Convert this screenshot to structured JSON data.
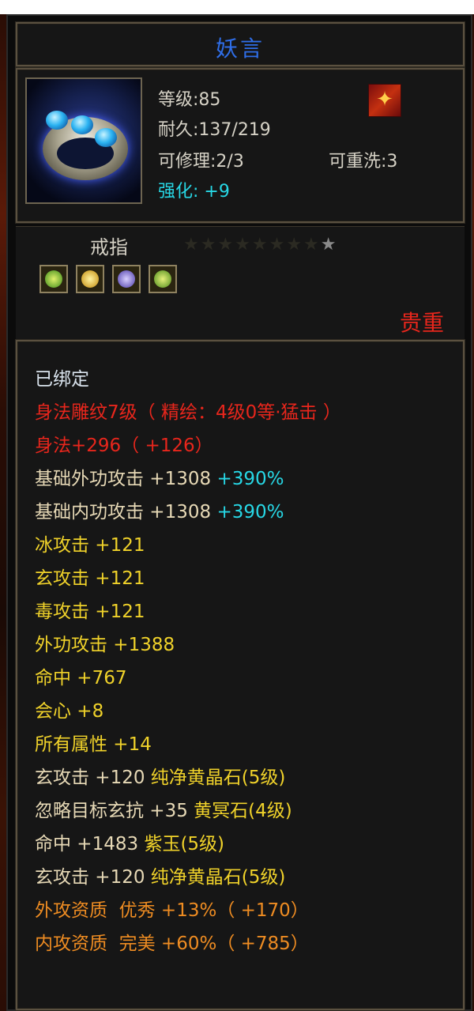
{
  "item": {
    "name": "妖言",
    "level": "等级:85",
    "durability": "耐久:137/219",
    "repairable": "可修理:2/3",
    "rewash": "可重洗:3",
    "enhance": "强化: +9",
    "type": "戒指",
    "stars": "★★★★★★★★",
    "last_star": "★",
    "rarity": "贵重"
  },
  "colors": {
    "title": "#2f6ee8",
    "red": "#e8261c",
    "cyan": "#27d8e6",
    "yellow": "#f0d22a",
    "beige": "#e7d9b6",
    "orange": "#ee8c22",
    "white": "#d8e2ec"
  },
  "icons": [
    "ring-item-icon",
    "class-emblem-icon",
    "gem-slot-green",
    "gem-slot-yellow",
    "gem-slot-purple",
    "gem-slot-green"
  ],
  "attributes": [
    {
      "parts": [
        {
          "text": "已绑定",
          "color": "white"
        }
      ]
    },
    {
      "parts": [
        {
          "text": "身法雕纹7级（ 精绘：4级0等·猛击 ）",
          "color": "red"
        }
      ]
    },
    {
      "parts": [
        {
          "text": "身法+296（ +126）",
          "color": "red"
        }
      ]
    },
    {
      "parts": [
        {
          "text": "基础外功攻击 +1308 ",
          "color": "beige"
        },
        {
          "text": "+390%",
          "color": "cyan"
        }
      ]
    },
    {
      "parts": [
        {
          "text": "基础内功攻击 +1308 ",
          "color": "beige"
        },
        {
          "text": "+390%",
          "color": "cyan"
        }
      ]
    },
    {
      "parts": [
        {
          "text": "冰攻击 +121",
          "color": "yellow"
        }
      ]
    },
    {
      "parts": [
        {
          "text": "玄攻击 +121",
          "color": "yellow"
        }
      ]
    },
    {
      "parts": [
        {
          "text": "毒攻击 +121",
          "color": "yellow"
        }
      ]
    },
    {
      "parts": [
        {
          "text": "外功攻击 +1388",
          "color": "yellow"
        }
      ]
    },
    {
      "parts": [
        {
          "text": "命中 +767",
          "color": "yellow"
        }
      ]
    },
    {
      "parts": [
        {
          "text": "会心 +8",
          "color": "yellow"
        }
      ]
    },
    {
      "parts": [
        {
          "text": "所有属性 +14",
          "color": "yellow"
        }
      ]
    },
    {
      "parts": [
        {
          "text": "玄攻击 +120 ",
          "color": "beige"
        },
        {
          "text": "纯净黄晶石(5级)",
          "color": "yellow"
        }
      ]
    },
    {
      "parts": [
        {
          "text": "忽略目标玄抗 +35 ",
          "color": "beige"
        },
        {
          "text": "黄冥石(4级)",
          "color": "yellow"
        }
      ]
    },
    {
      "parts": [
        {
          "text": "命中 +1483 ",
          "color": "beige"
        },
        {
          "text": "紫玉(5级)",
          "color": "yellow"
        }
      ]
    },
    {
      "parts": [
        {
          "text": "玄攻击 +120 ",
          "color": "beige"
        },
        {
          "text": "纯净黄晶石(5级)",
          "color": "yellow"
        }
      ]
    },
    {
      "parts": [
        {
          "text": "外攻资质  优秀 +13%（ +170）",
          "color": "orange"
        }
      ]
    },
    {
      "parts": [
        {
          "text": "内攻资质  完美 +60%（ +785）",
          "color": "orange"
        }
      ]
    }
  ]
}
